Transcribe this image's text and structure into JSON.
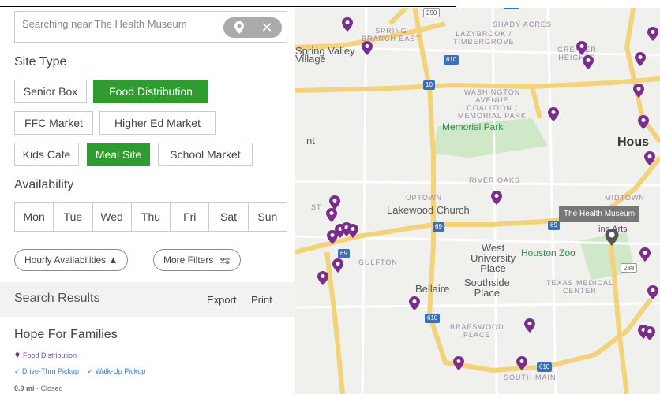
{
  "search": {
    "value": "Searching near The Health Museum"
  },
  "site_type": {
    "title": "Site Type",
    "chips": [
      {
        "label": "Senior Box",
        "active": false
      },
      {
        "label": "Food Distribution",
        "active": true
      },
      {
        "label": "FFC Market",
        "active": false
      },
      {
        "label": "Higher Ed Market",
        "active": false
      },
      {
        "label": "Kids Cafe",
        "active": false
      },
      {
        "label": "Meal Site",
        "active": true
      },
      {
        "label": "School Market",
        "active": false
      }
    ]
  },
  "availability": {
    "title": "Availability",
    "days": [
      "Mon",
      "Tue",
      "Wed",
      "Thu",
      "Fri",
      "Sat",
      "Sun"
    ]
  },
  "filters": {
    "hourly": "Hourly Availabilities ▲",
    "more": "More Filters"
  },
  "results": {
    "title": "Search Results",
    "export": "Export",
    "print": "Print",
    "items": [
      {
        "name": "Hope For Families",
        "type": "Food Distribution",
        "features": [
          "✓ Drive-Thru Pickup",
          "✓ Walk-Up Pickup"
        ],
        "distance": "0.9 mi",
        "status": "Closed"
      }
    ]
  },
  "map": {
    "labels": {
      "spring_branch": "SPRING\nBRANCH EAST",
      "lazybrook": "LAZYBROOK /\nTIMBERGROVE",
      "shady_acres": "SHADY ACRES",
      "greater_heights": "GREATER\nHEIGHTS",
      "spring_valley": "Spring Valley\nVillage",
      "washington": "WASHINGTON\nAVENUE\nCOALITION /\nMEMORIAL PARK",
      "memorial_park": "Memorial Park",
      "houston": "Hous",
      "river_oaks": "RIVER OAKS",
      "uptown": "UPTOWN",
      "lakewood": "Lakewood Church",
      "midtown": "MIDTOWN",
      "fine_arts": "ine Arts",
      "west_univ": "West\nUniversity\nPlace",
      "houston_zoo": "Houston Zoo",
      "gulfton": "GULFTON",
      "bellaire": "Bellaire",
      "southside": "Southside\nPlace",
      "medical": "TEXAS MEDICAL\nCENTER",
      "braeswood": "BRAESWOOD\nPLACE",
      "south_main": "SOUTH MAIN",
      "nt": "nt",
      "st": "ST"
    },
    "museum_tag": "The Health Museum",
    "shields": {
      "h290": "290",
      "h610a": "610",
      "h610b": "610",
      "h610c": "610",
      "h610d": "610",
      "h10": "10",
      "h69a": "69",
      "h69b": "69",
      "h69c": "69",
      "h288": "288"
    },
    "colors": {
      "pin": "#7b2d8e",
      "active_chip": "#2e9c2e",
      "highway": "#f3d27a",
      "park": "#cfe8c8"
    }
  }
}
